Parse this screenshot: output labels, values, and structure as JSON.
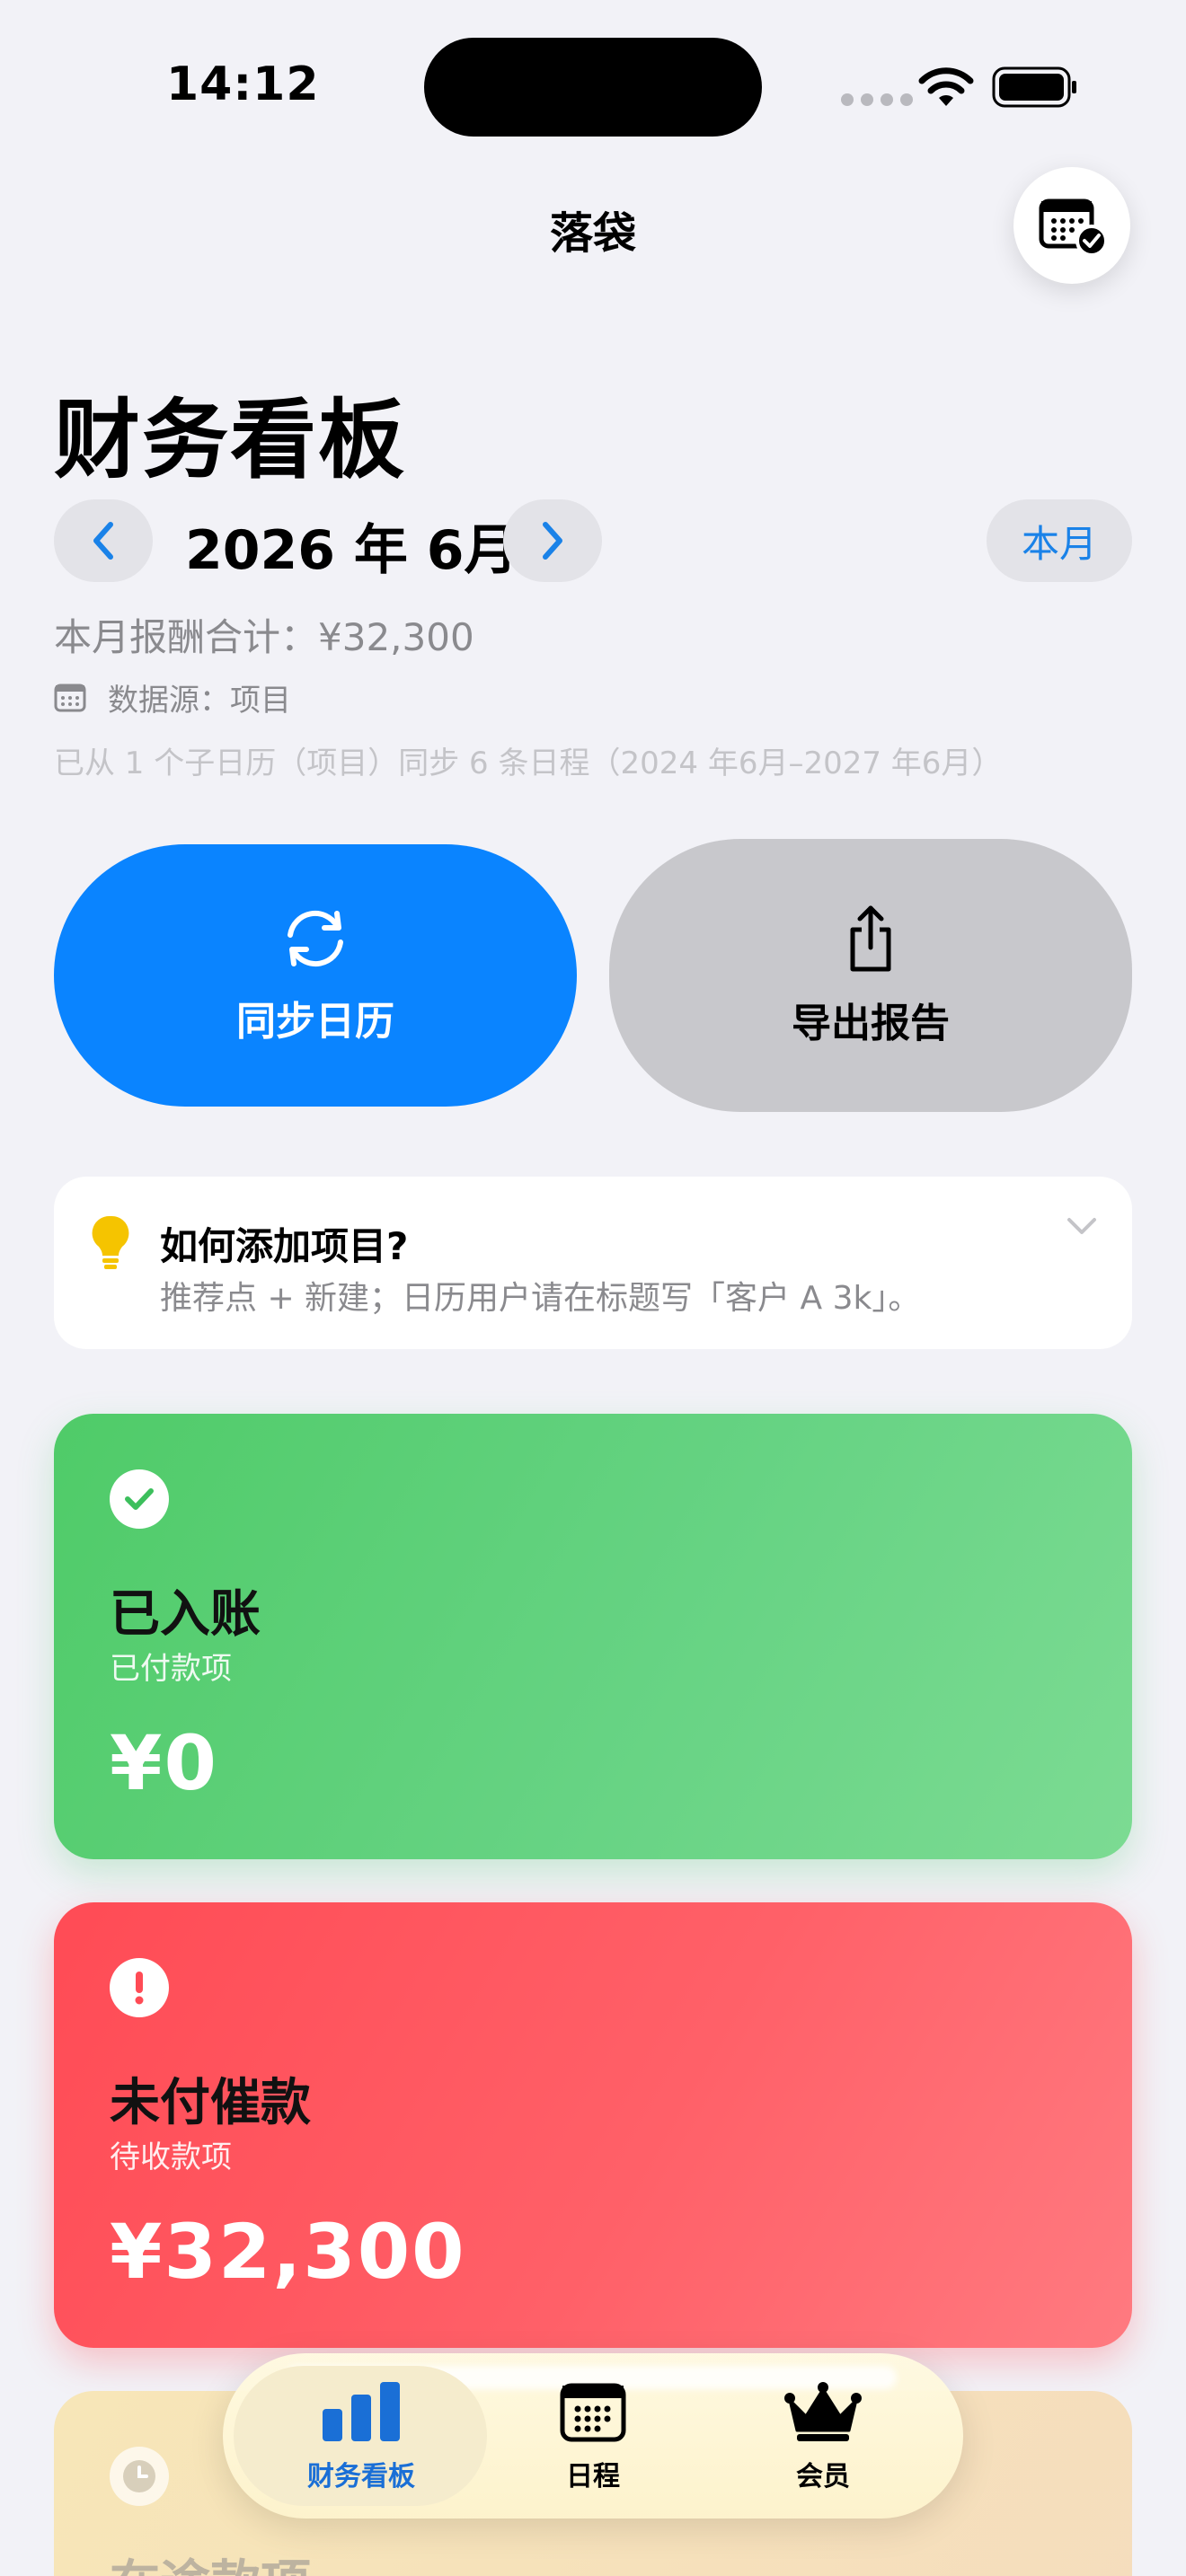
{
  "status_bar": {
    "time": "14:12"
  },
  "nav": {
    "title": "落袋",
    "calendar_icon": "calendar-check-icon"
  },
  "page": {
    "title": "财务看板"
  },
  "month_nav": {
    "label": "2026 年 6月",
    "this_month_label": "本月"
  },
  "summary": {
    "total_line": "本月报酬合计：¥32,300",
    "source_line": "数据源：项目",
    "sync_line": "已从 1 个子日历（项目）同步 6 条日程（2024 年6月–2027 年6月）"
  },
  "actions": {
    "sync_label": "同步日历",
    "export_label": "导出报告"
  },
  "tip": {
    "title": "如何添加项目?",
    "description": "推荐点 + 新建；日历用户请在标题写「客户 A 3k」。"
  },
  "cards": {
    "paid": {
      "title": "已入账",
      "subtitle": "已付款项",
      "amount": "¥0",
      "color": "#4fcb68"
    },
    "unpaid": {
      "title": "未付催款",
      "subtitle": "待收款项",
      "amount": "¥32,300",
      "color": "#ff4b55"
    },
    "transit": {
      "title": "在途款项"
    }
  },
  "tabbar": {
    "tabs": [
      {
        "label": "财务看板",
        "icon": "bar-chart-icon",
        "active": true
      },
      {
        "label": "日程",
        "icon": "calendar-icon",
        "active": false
      },
      {
        "label": "会员",
        "icon": "crown-icon",
        "active": false
      }
    ],
    "accent": "#1a6fd6"
  }
}
